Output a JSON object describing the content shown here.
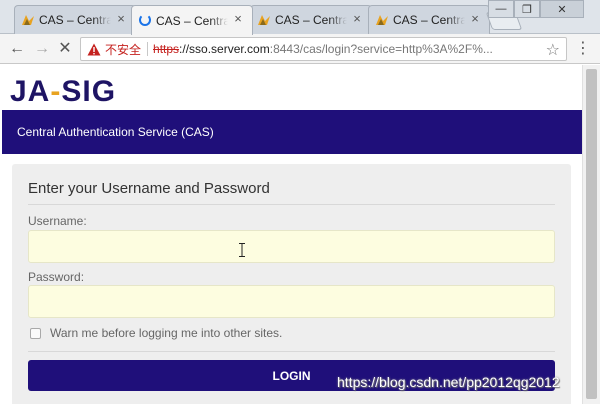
{
  "browser": {
    "tabs": [
      {
        "title": "CAS – Central Authentication Service",
        "state": "idle"
      },
      {
        "title": "CAS – Central Authentication Service",
        "state": "loading"
      },
      {
        "title": "CAS – Central Authentication Service",
        "state": "idle"
      },
      {
        "title": "CAS – Central Authentication Service",
        "state": "idle"
      }
    ],
    "close_glyph": "×",
    "window_controls": [
      "—",
      "❐",
      "✕"
    ],
    "nav": {
      "back": "←",
      "forward": "→",
      "stop": "✕"
    },
    "address": {
      "security_label": "不安全",
      "url_scheme": "https",
      "url_host": "://sso.server.com",
      "url_rest": ":8443/cas/login?service=http%3A%2F%..."
    },
    "star": "☆",
    "menu": "⋮"
  },
  "page": {
    "logo_left": "JA",
    "logo_dash": "-",
    "logo_right": "SIG",
    "banner_text": "Central Authentication Service (CAS)",
    "form": {
      "heading": "Enter your Username and Password",
      "username_label": "Username:",
      "username_value": "",
      "password_label": "Password:",
      "password_value": "",
      "warn_label": "Warn me before logging me into other sites.",
      "login_label": "LOGIN"
    }
  },
  "watermark": "https://blog.csdn.net/pp2012qg2012",
  "colors": {
    "brand": "#1f0f7a",
    "logo": "#1e1464",
    "logo_accent": "#e8a321",
    "input_bg": "#fdfde0",
    "insecure_red": "#c5221f"
  }
}
